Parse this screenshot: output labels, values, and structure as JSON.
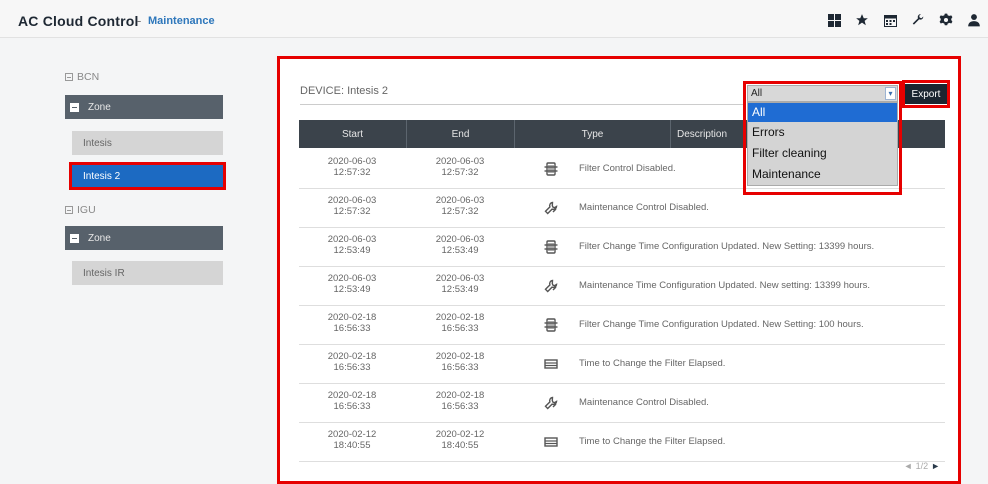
{
  "header": {
    "app_title": "AC Cloud Control",
    "separator": "-",
    "section_title": "Maintenance",
    "icons": [
      "grid-icon",
      "star-icon",
      "calendar-icon",
      "wrench-icon",
      "gear-icon",
      "user-icon"
    ]
  },
  "sidebar": {
    "groups": [
      {
        "site": "BCN",
        "zone": "Zone",
        "devices": [
          {
            "label": "Intesis",
            "active": false
          },
          {
            "label": "Intesis 2",
            "active": true
          }
        ]
      },
      {
        "site": "IGU",
        "zone": "Zone",
        "devices": [
          {
            "label": "Intesis IR",
            "active": false
          }
        ]
      }
    ]
  },
  "main": {
    "device_title": "DEVICE: Intesis 2",
    "filter": {
      "selected": "All",
      "options": [
        "All",
        "Errors",
        "Filter cleaning",
        "Maintenance"
      ]
    },
    "export_label": "Export",
    "columns": [
      "Start",
      "End",
      "Type",
      "Description"
    ],
    "rows": [
      {
        "start_date": "2020-06-03",
        "start_time": "12:57:32",
        "end_date": "2020-06-03",
        "end_time": "12:57:32",
        "icon": "filter-icon",
        "type": "Filter Control Disabled."
      },
      {
        "start_date": "2020-06-03",
        "start_time": "12:57:32",
        "end_date": "2020-06-03",
        "end_time": "12:57:32",
        "icon": "maintenance-icon",
        "type": "Maintenance Control Disabled."
      },
      {
        "start_date": "2020-06-03",
        "start_time": "12:53:49",
        "end_date": "2020-06-03",
        "end_time": "12:53:49",
        "icon": "filter-icon",
        "type": "Filter Change Time Configuration Updated. New Setting: 13399 hours."
      },
      {
        "start_date": "2020-06-03",
        "start_time": "12:53:49",
        "end_date": "2020-06-03",
        "end_time": "12:53:49",
        "icon": "maintenance-icon",
        "type": "Maintenance Time Configuration Updated. New setting: 13399 hours."
      },
      {
        "start_date": "2020-02-18",
        "start_time": "16:56:33",
        "end_date": "2020-02-18",
        "end_time": "16:56:33",
        "icon": "filter-icon",
        "type": "Filter Change Time Configuration Updated. New Setting: 100 hours."
      },
      {
        "start_date": "2020-02-18",
        "start_time": "16:56:33",
        "end_date": "2020-02-18",
        "end_time": "16:56:33",
        "icon": "filter-elapsed-icon",
        "type": "Time to Change the Filter Elapsed."
      },
      {
        "start_date": "2020-02-18",
        "start_time": "16:56:33",
        "end_date": "2020-02-18",
        "end_time": "16:56:33",
        "icon": "maintenance-icon",
        "type": "Maintenance Control Disabled."
      },
      {
        "start_date": "2020-02-12",
        "start_time": "18:40:55",
        "end_date": "2020-02-12",
        "end_time": "18:40:55",
        "icon": "filter-elapsed-icon",
        "type": "Time to Change the Filter Elapsed."
      }
    ],
    "pagination": {
      "text": "1/2",
      "prev": "◄",
      "next": "►"
    }
  },
  "colors": {
    "highlight_outline": "#e60000",
    "active_item": "#1c6ac2",
    "header_bar": "#3b434b",
    "accent": "#2e77bb"
  }
}
